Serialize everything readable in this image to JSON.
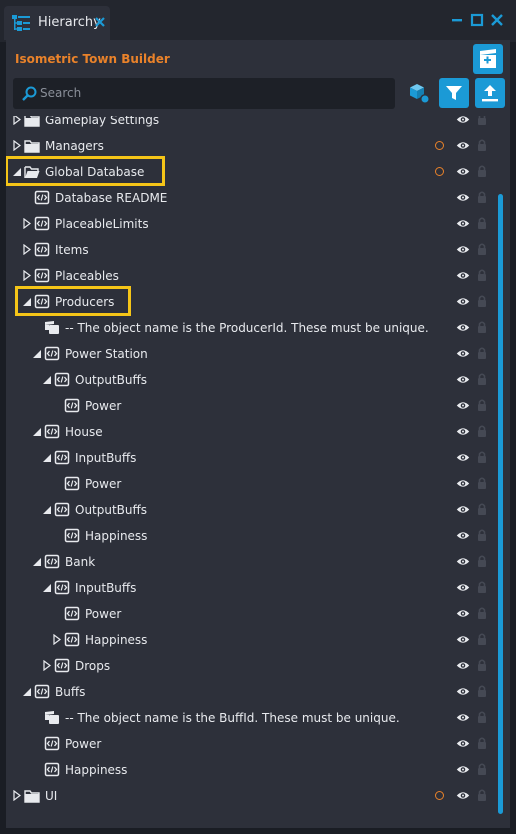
{
  "tab": {
    "label": "Hierarchy"
  },
  "panel": {
    "title": "Isometric Town Builder"
  },
  "search": {
    "placeholder": "Search"
  },
  "colors": {
    "accent": "#1b9ad6",
    "title": "#e9822a",
    "highlight": "#f5c518",
    "dirty_marker": "#e9822a"
  },
  "tree": [
    {
      "label": "Gameplay Settings",
      "icon": "folder-icon",
      "arrow": "collapsed-arrow",
      "dirty": false
    },
    {
      "label": "Managers",
      "icon": "folder-icon",
      "arrow": "collapsed-arrow",
      "dirty": true
    },
    {
      "label": "Global Database",
      "icon": "folder-open-icon",
      "arrow": "expanded-arrow",
      "dirty": true,
      "highlighted": true
    },
    {
      "label": "Database README",
      "icon": "script-icon",
      "arrow": "",
      "dirty": false
    },
    {
      "label": "PlaceableLimits",
      "icon": "script-icon",
      "arrow": "collapsed-arrow",
      "dirty": false
    },
    {
      "label": "Items",
      "icon": "script-icon",
      "arrow": "collapsed-arrow",
      "dirty": false
    },
    {
      "label": "Placeables",
      "icon": "script-icon",
      "arrow": "collapsed-arrow",
      "dirty": false
    },
    {
      "label": "Producers",
      "icon": "script-icon",
      "arrow": "expanded-arrow",
      "dirty": false,
      "highlighted": true
    },
    {
      "label": "-- The object name is the ProducerId. These must be unique.",
      "icon": "comment-icon",
      "arrow": "",
      "dirty": false
    },
    {
      "label": "Power Station",
      "icon": "script-icon",
      "arrow": "expanded-arrow",
      "dirty": false
    },
    {
      "label": "OutputBuffs",
      "icon": "script-icon",
      "arrow": "expanded-arrow",
      "dirty": false
    },
    {
      "label": "Power",
      "icon": "script-icon",
      "arrow": "",
      "dirty": false
    },
    {
      "label": "House",
      "icon": "script-icon",
      "arrow": "expanded-arrow",
      "dirty": false
    },
    {
      "label": "InputBuffs",
      "icon": "script-icon",
      "arrow": "expanded-arrow",
      "dirty": false
    },
    {
      "label": "Power",
      "icon": "script-icon",
      "arrow": "",
      "dirty": false
    },
    {
      "label": "OutputBuffs",
      "icon": "script-icon",
      "arrow": "expanded-arrow",
      "dirty": false
    },
    {
      "label": "Happiness",
      "icon": "script-icon",
      "arrow": "",
      "dirty": false
    },
    {
      "label": "Bank",
      "icon": "script-icon",
      "arrow": "expanded-arrow",
      "dirty": false
    },
    {
      "label": "InputBuffs",
      "icon": "script-icon",
      "arrow": "expanded-arrow",
      "dirty": false
    },
    {
      "label": "Power",
      "icon": "script-icon",
      "arrow": "",
      "dirty": false
    },
    {
      "label": "Happiness",
      "icon": "script-icon",
      "arrow": "collapsed-arrow",
      "dirty": false
    },
    {
      "label": "Drops",
      "icon": "script-icon",
      "arrow": "collapsed-arrow",
      "dirty": false
    },
    {
      "label": "Buffs",
      "icon": "script-icon",
      "arrow": "expanded-arrow",
      "dirty": false
    },
    {
      "label": "-- The object name is the BuffId. These must be unique.",
      "icon": "comment-icon",
      "arrow": "",
      "dirty": false
    },
    {
      "label": "Power",
      "icon": "script-icon",
      "arrow": "",
      "dirty": false
    },
    {
      "label": "Happiness",
      "icon": "script-icon",
      "arrow": "",
      "dirty": false
    },
    {
      "label": "UI",
      "icon": "folder-icon",
      "arrow": "collapsed-arrow",
      "dirty": true
    }
  ]
}
